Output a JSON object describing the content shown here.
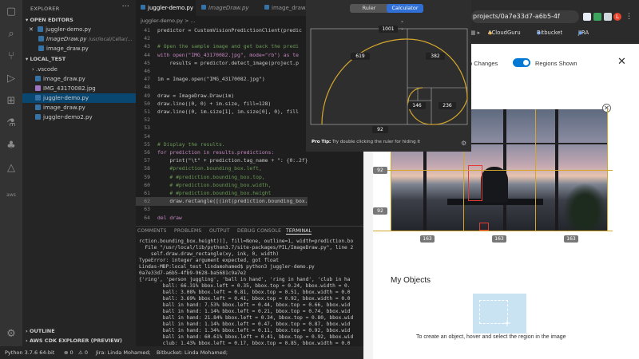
{
  "vscode": {
    "explorer": {
      "title": "EXPLORER",
      "open_editors_header": "OPEN EDITORS",
      "open_editors": [
        {
          "close": "✕",
          "name": "juggler-demo.py",
          "path": ""
        },
        {
          "name": "ImageDraw.py",
          "path": "/usr/local/Cellar/..."
        },
        {
          "name": "image_draw.py",
          "path": ""
        }
      ],
      "folder_header": "LOCAL_TEST",
      "files": [
        ".vscode",
        "image_draw.py",
        "IMG_43170082.jpg",
        "juggler-demo.py",
        "image_draw.py",
        "juggler-demo2.py"
      ],
      "outline_header": "OUTLINE",
      "cdk_header": "AWS CDK EXPLORER (PREVIEW)"
    },
    "tabs": [
      "juggler-demo.py",
      "ImageDraw.py",
      "image_draw.py"
    ],
    "breadcrumb": "juggler-demo.py > ...",
    "code_lines": [
      {
        "n": "41",
        "t": "predictor = CustomVisionPredictionClient(predic",
        "c": "def"
      },
      {
        "n": "42",
        "t": "",
        "c": "def"
      },
      {
        "n": "43",
        "t": "# Open the sample image and get back the predi",
        "c": "cm"
      },
      {
        "n": "44",
        "t": "with open(\"IMG_43170082.jpg\", mode=\"rb\") as te",
        "c": "kw"
      },
      {
        "n": "45",
        "t": "    results = predictor.detect_image(project.p",
        "c": "def"
      },
      {
        "n": "46",
        "t": "",
        "c": "def"
      },
      {
        "n": "47",
        "t": "im = Image.open(\"IMG_43170082.jpg\")",
        "c": "def"
      },
      {
        "n": "48",
        "t": "",
        "c": "def"
      },
      {
        "n": "49",
        "t": "draw = ImageDraw.Draw(im)",
        "c": "def"
      },
      {
        "n": "50",
        "t": "draw.line((0, 0) + im.size, fill=128)",
        "c": "def"
      },
      {
        "n": "51",
        "t": "draw.line((0, im.size[1], im.size[0], 0), fill",
        "c": "def"
      },
      {
        "n": "52",
        "t": "",
        "c": "def"
      },
      {
        "n": "53",
        "t": "",
        "c": "def"
      },
      {
        "n": "54",
        "t": "",
        "c": "def"
      },
      {
        "n": "55",
        "t": "# Display the results.",
        "c": "cm"
      },
      {
        "n": "56",
        "t": "for prediction in results.predictions:",
        "c": "kw"
      },
      {
        "n": "57",
        "t": "    print(\"\\t\" + prediction.tag_name + \": {0:.2f}% bbox.left = ",
        "c": "def"
      },
      {
        "n": "58",
        "t": "    #prediction.bounding_box.left,",
        "c": "cm"
      },
      {
        "n": "59",
        "t": "    # #prediction.bounding_box.top,",
        "c": "cm"
      },
      {
        "n": "60",
        "t": "    # #prediction.bounding_box.width,",
        "c": "cm"
      },
      {
        "n": "61",
        "t": "    # #prediction.bounding_box.height",
        "c": "cm"
      },
      {
        "n": "62",
        "t": "    draw.rectangle([(int(prediction.bounding_box.left=100], int",
        "c": "def"
      },
      {
        "n": "63",
        "t": "",
        "c": "def"
      },
      {
        "n": "64",
        "t": "del draw",
        "c": "kw"
      }
    ],
    "panel_tabs": [
      "COMMENTS",
      "PROBLEMS",
      "OUTPUT",
      "DEBUG CONSOLE",
      "TERMINAL"
    ],
    "terminal_lines": [
      "rction.bounding_box.height))], fill=None, outline=1, width=prediction.bo",
      "  File \"/usr/local/lib/python3.7/site-packages/PIL/ImageDraw.py\", line 2",
      "    self.draw.draw_rectangle(xy, ink, 0, width)",
      "TypeError: integer argument expected, got float",
      "Lindas-MBP:local_test lindamohamed$ python3 juggler-demo.py",
      "0a7e33d7-a6b5-4fb9-9628-ba5681c9a7e2",
      "{'ring', 'person juggling', 'ball in hand', 'ring in hand', 'club in ha",
      "        ball: 66.31% bbox.left = 0.35, bbox.top = 0.24, bbox.width = 0.",
      "        ball: 3.08% bbox.left = 0.81, bbox.top = 0.51, bbox.width = 0.0",
      "        ball: 3.69% bbox.left = 0.41, bbox.top = 0.92, bbox.width = 0.0",
      "        ball in hand: 7.53% bbox.left = 0.44, bbox.top = 0.66, bbox.wid",
      "        ball in hand: 1.14% bbox.left = 0.21, bbox.top = 0.74, bbox.wid",
      "        ball in hand: 21.84% bbox.left = 0.34, bbox.top = 0.80, bbox.wid",
      "        ball in hand: 1.14% bbox.left = 0.47, bbox.top = 0.87, bbox.wid",
      "        ball in hand: 1.34% bbox.left = 0.11, bbox.top = 0.92, bbox.wid",
      "        ball in hand: 60.61% bbox.left = 0.41, bbox.top = 0.92, bbox.wid",
      "        club: 1.43% bbox.left = 0.17, bbox.top = 0.85, bbox.width = 0.0"
    ],
    "status": {
      "python": "Python 3.7.6 64-bit",
      "errors": "⊗ 0",
      "warnings": "⚠ 0",
      "jira": "Jira: Linda Mohamed;",
      "bitbucket": "Bitbucket: Linda Mohamed;"
    }
  },
  "ruler_app": {
    "tabs": [
      "Ruler",
      "Calculator"
    ],
    "active_tab": "Calculator",
    "measurements": {
      "top": "1001",
      "left": "619",
      "right": "382",
      "small_left": "146",
      "small_right": "236",
      "bottom": "92"
    },
    "pro_tip_label": "Pro Tip:",
    "pro_tip_text": "Try double clicking the ruler for hiding it"
  },
  "browser": {
    "url": "projects/0a7e33d7-a6b5-4f",
    "bookmarks": [
      "ACloudGuru",
      "Bitbucket",
      "JIRA"
    ],
    "avatar_letter": "L",
    "changes_label": "o Changes",
    "regions_label": "Regions Shown",
    "regions_toggle_on": true,
    "photo_measurements": {
      "left_top": "92",
      "left_bottom": "92",
      "bottom_left": "163",
      "bottom_mid": "163",
      "bottom_right": "163"
    },
    "my_objects_title": "My Objects",
    "create_object_text": "To create an object, hover and select the region in the image",
    "accent": "#0078d4",
    "ruler_gold": "#d4a72c"
  }
}
